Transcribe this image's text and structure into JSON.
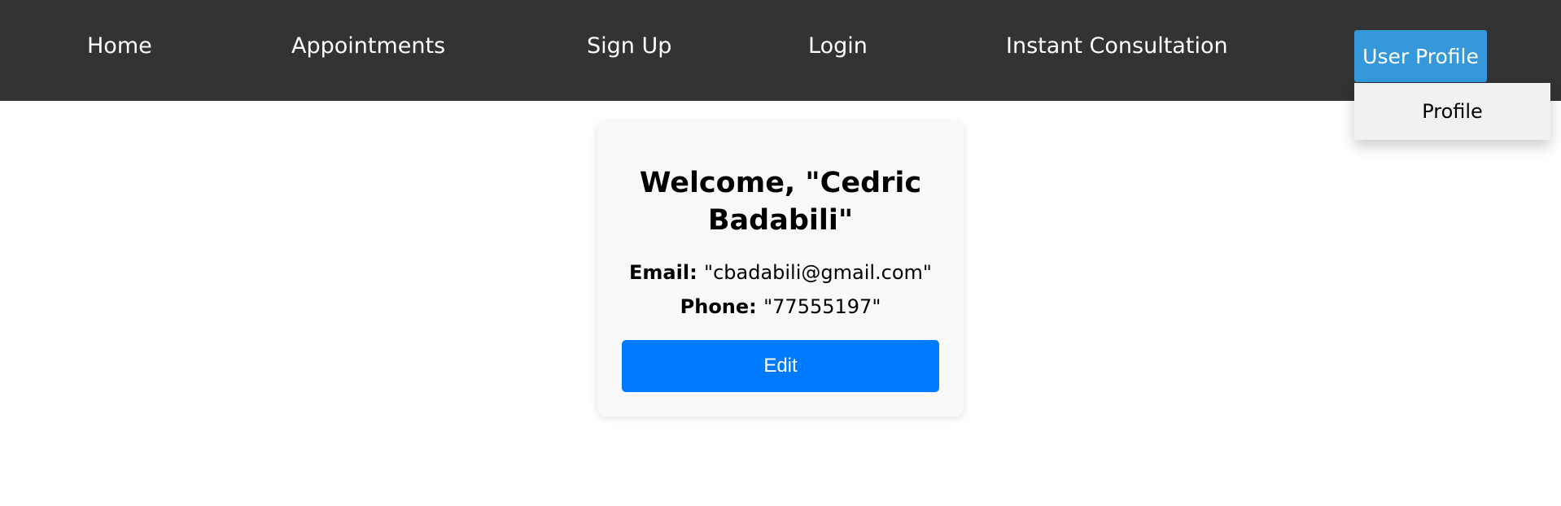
{
  "navbar": {
    "links": [
      {
        "label": "Home"
      },
      {
        "label": "Appointments"
      },
      {
        "label": "Sign Up"
      },
      {
        "label": "Login"
      },
      {
        "label": "Instant Consultation"
      }
    ],
    "user_menu": {
      "label": "User Profile",
      "dropdown_items": [
        {
          "label": "Profile"
        }
      ]
    },
    "colors": {
      "background": "#333333",
      "user_button": "#3498db",
      "dropdown": "#f1f1f1"
    }
  },
  "profile_card": {
    "welcome": "Welcome, \"Cedric Badabili\"",
    "email_label": "Email:",
    "email_value": "\"cbadabili@gmail.com\"",
    "phone_label": "Phone:",
    "phone_value": "\"77555197\"",
    "edit_label": "Edit",
    "colors": {
      "card": "#f9f9f9",
      "edit_button": "#007bff"
    }
  }
}
